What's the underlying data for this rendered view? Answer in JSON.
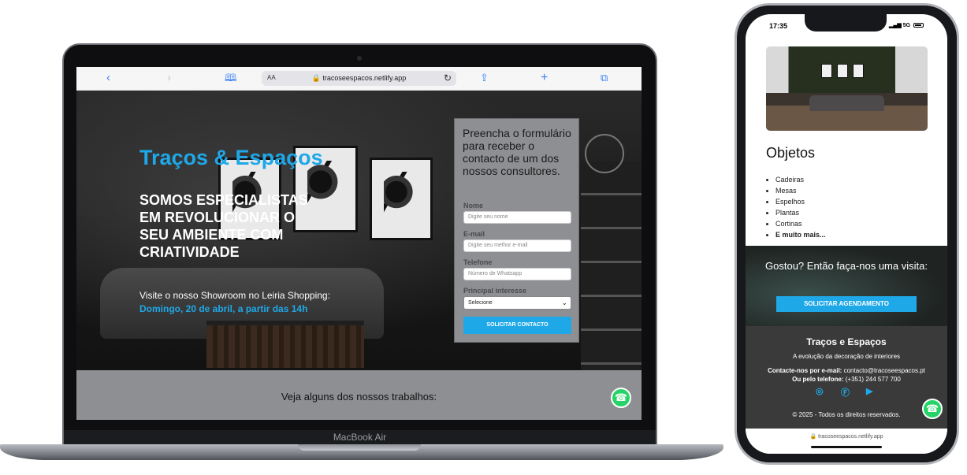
{
  "laptop": {
    "model_label": "MacBook Air",
    "browser": {
      "aa_label": "AA",
      "url": "🔒 tracoseespacos.netlify.app",
      "back_icon": "chevron-left-icon",
      "forward_icon": "chevron-right-icon",
      "bookmarks_icon": "book-icon",
      "share_icon": "share-icon",
      "new_tab_icon": "plus-icon",
      "tabs_icon": "tabs-icon"
    },
    "hero": {
      "title": "Traços & Espaços",
      "tagline": "SOMOS ESPECIALISTAS EM REVOLUCIONAR O SEU AMBIENTE COM CRIATIVIDADE",
      "visit_text": "Visite o nosso Showroom no Leiria Shopping:",
      "visit_date": "Domingo, 20 de abril, a partir das 14h"
    },
    "form": {
      "heading": "Preencha o formulário para receber o contacto de um dos nossos consultores.",
      "name_label": "Nome",
      "name_placeholder": "Digite seu nome",
      "email_label": "E-mail",
      "email_placeholder": "Digite seu melhor e-mail",
      "phone_label": "Telefone",
      "phone_placeholder": "Número de Whatsapp",
      "interest_label": "Principal interesse",
      "interest_selected": "Selecione",
      "submit_label": "SOLICITAR CONTACTO"
    },
    "works_text": "Veja alguns dos nossos trabalhos:"
  },
  "phone": {
    "time": "17:35",
    "network": "5G",
    "section_heading": "Objetos",
    "items": [
      "Cadeiras",
      "Mesas",
      "Espelhos",
      "Plantas",
      "Cortinas",
      "E muito mais..."
    ],
    "cta_text": "Gostou? Então faça-nos uma visita:",
    "cta_button": "SOLICITAR AGENDAMENTO",
    "footer": {
      "title": "Traços e Espaços",
      "subtitle": "A evolução da decoração de interiores",
      "email_label": "Contacte-nos por e-mail:",
      "email_value": "contacto@tracoseespacos.pt",
      "phone_label": "Ou pelo telefone:",
      "phone_value": "(+351) 244 577 700",
      "copyright": "© 2025 - Todos os direitos reservados."
    },
    "url": "🔒 tracoseespacos.netlify.app"
  },
  "colors": {
    "accent": "#1fa8e8",
    "form_bg": "#8d8f92",
    "footer_bg": "#3a3a3a",
    "whatsapp": "#25d366"
  }
}
